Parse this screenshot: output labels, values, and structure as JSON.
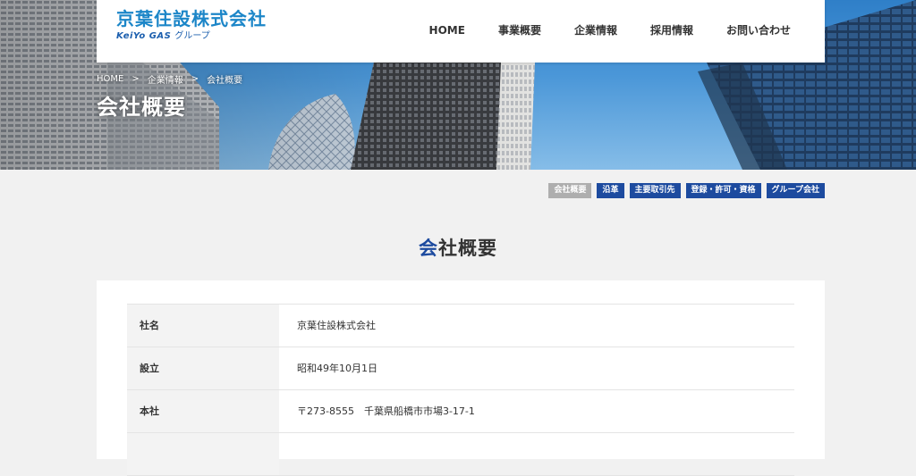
{
  "header": {
    "logo_main": "京葉住設株式会社",
    "logo_brand": "KeiYo GAS",
    "logo_group": "グループ",
    "nav": [
      "HOME",
      "事業概要",
      "企業情報",
      "採用情報",
      "お問い合わせ"
    ]
  },
  "hero": {
    "breadcrumb": [
      "HOME",
      "企業情報",
      "会社概要"
    ],
    "breadcrumb_sep": ">",
    "title": "会社概要"
  },
  "tabs": [
    {
      "label": "会社概要",
      "active": true
    },
    {
      "label": "沿革",
      "active": false
    },
    {
      "label": "主要取引先",
      "active": false
    },
    {
      "label": "登録・許可・資格",
      "active": false
    },
    {
      "label": "グループ会社",
      "active": false
    }
  ],
  "section": {
    "title_first": "会",
    "title_rest": "社概要"
  },
  "company_table": [
    {
      "label": "社名",
      "value": "京葉住設株式会社"
    },
    {
      "label": "設立",
      "value": "昭和49年10月1日"
    },
    {
      "label": "本社",
      "value": "〒273-8555　千葉県船橋市市場3-17-1"
    },
    {
      "label": "",
      "value": ""
    }
  ],
  "colors": {
    "accent": "#1d4b9f",
    "logo": "#1c86c8",
    "tab_active": "#aeaeae",
    "page_bg": "#f1f1f1"
  }
}
